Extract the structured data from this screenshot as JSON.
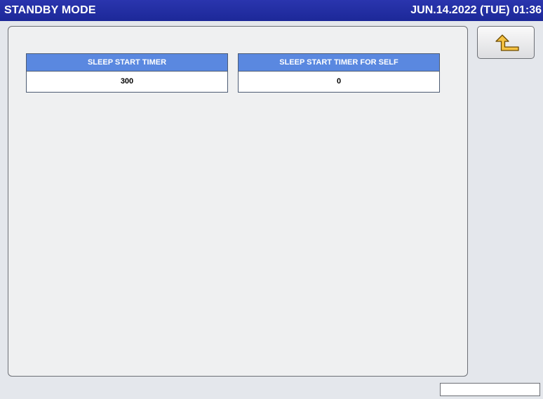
{
  "header": {
    "title": "STANDBY MODE",
    "datetime": "JUN.14.2022 (TUE)  01:36"
  },
  "settings": [
    {
      "label": "SLEEP START TIMER",
      "value": "300"
    },
    {
      "label": "SLEEP START TIMER FOR SELF",
      "value": "0"
    }
  ],
  "back_button": {
    "icon": "return-arrow-icon"
  },
  "colors": {
    "title_bar": "#1f2a9c",
    "setting_header": "#5a88e0",
    "back_arrow_fill": "#f5c242",
    "back_arrow_stroke": "#6b4a00"
  }
}
